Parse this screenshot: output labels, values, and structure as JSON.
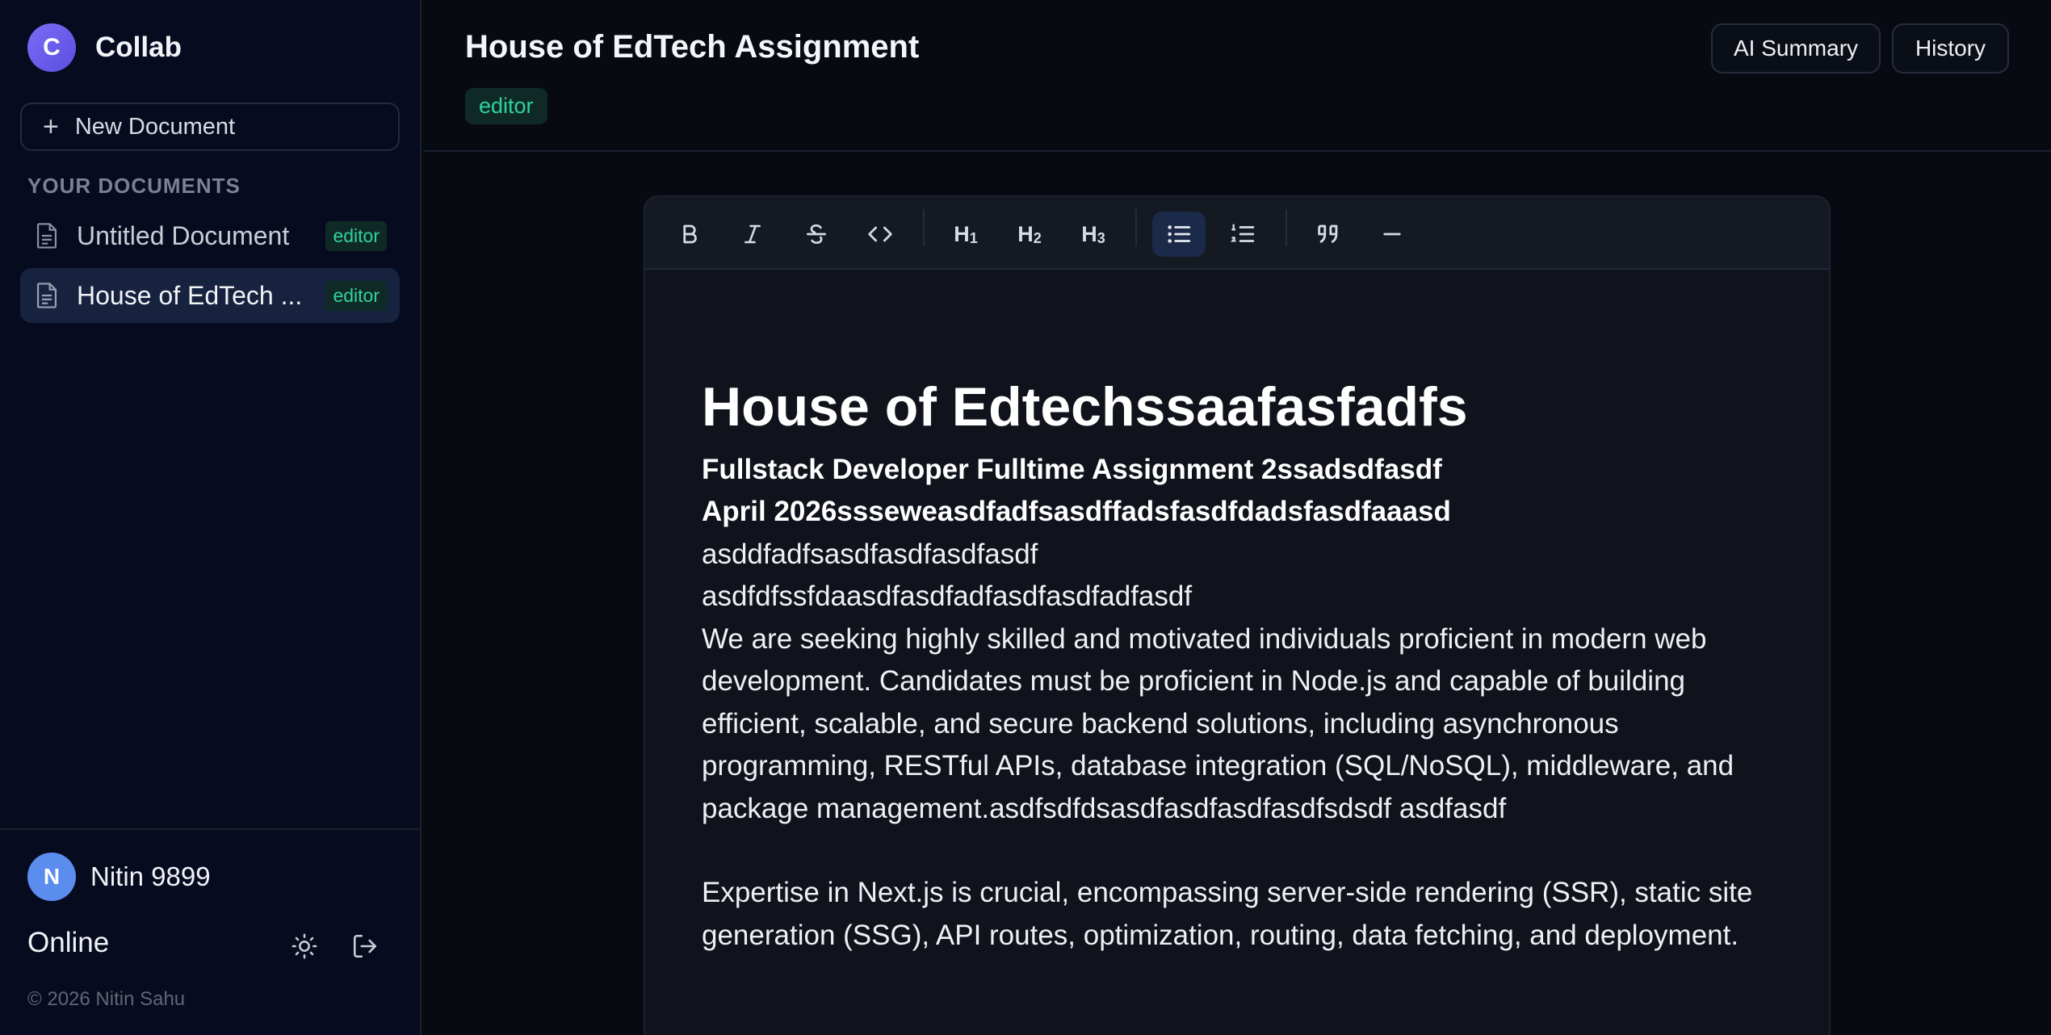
{
  "app": {
    "name": "Collab",
    "logo_letter": "C"
  },
  "sidebar": {
    "new_document_label": "New Document",
    "section_label": "YOUR DOCUMENTS",
    "documents": [
      {
        "title": "Untitled Document",
        "role": "editor",
        "active": false
      },
      {
        "title": "House of EdTech ...",
        "role": "editor",
        "active": true
      }
    ],
    "user": {
      "initial": "N",
      "name": "Nitin 9899"
    },
    "status": "Online",
    "copyright": "© 2026 Nitin Sahu"
  },
  "header": {
    "title": "House of EdTech Assignment",
    "role_badge": "editor",
    "ai_summary_label": "AI Summary",
    "history_label": "History"
  },
  "toolbar": {
    "buttons": [
      "bold",
      "italic",
      "strikethrough",
      "code",
      "heading-1",
      "heading-2",
      "heading-3",
      "bullet-list",
      "ordered-list",
      "blockquote",
      "horizontal-rule"
    ],
    "active": "bullet-list",
    "h1": "H",
    "h1_sub": "1",
    "h2": "H",
    "h2_sub": "2",
    "h3": "H",
    "h3_sub": "3"
  },
  "document": {
    "heading": "House of Edtechssaafasfadfs",
    "bold_line_1": "Fullstack Developer Fulltime Assignment 2ssadsdfasdf",
    "bold_line_2": "April 2026ssseweasdfadfsasdffadsfasdfdadsfasdfaaasd",
    "line_3": "asddfadfsasdfasdfasdfasdf",
    "line_4": "asdfdfssfdaasdfasdfadfasdfasdfadfasdf",
    "paragraph_1": "We are seeking highly skilled and motivated individuals proficient in modern web development. Candidates must be proficient in Node.js and capable of building efficient, scalable, and secure backend solutions, including asynchronous programming, RESTful APIs, database integration (SQL/NoSQL), middleware, and package management.asdfsdfdsasdfasdfasdfasdfsdsdf asdfasdf",
    "paragraph_2": "Expertise in Next.js is crucial, encompassing server-side rendering (SSR), static site generation (SSG), API routes, optimization, routing, data fetching, and deployment."
  },
  "colors": {
    "background": "#070a10",
    "sidebar": "#070b1f",
    "accent": "#6b5cf0",
    "role_badge": "#2fd39a",
    "active_item": "#16223e"
  }
}
